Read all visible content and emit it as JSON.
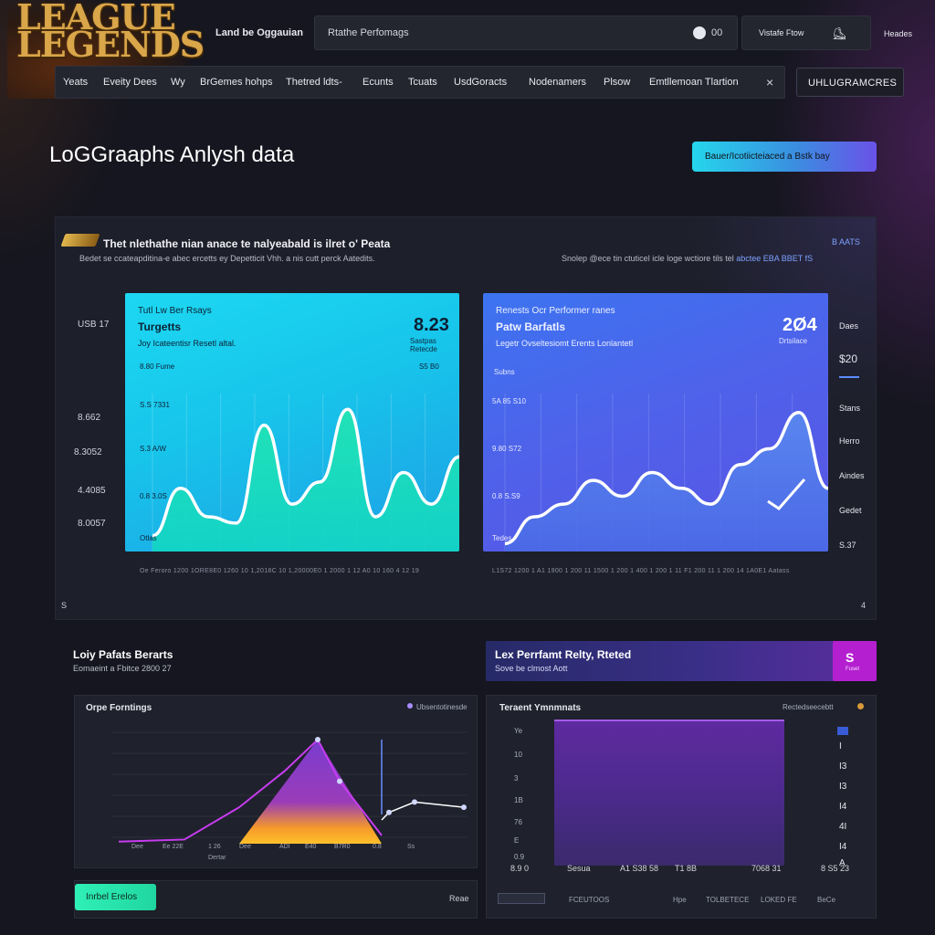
{
  "app": {
    "logo_line1": "LEAGUE",
    "logo_line2": "LEGENDS",
    "top_title": "Land be Oggauian",
    "search_text": "Rtathe Perfomags",
    "search_count": "00",
    "user_text": "Vistafe Ftow",
    "top_right": "Heades",
    "upgrade_button": "UHLUGRAMCRES",
    "nav_close": "×"
  },
  "nav": {
    "tabs": [
      "Yeats",
      "Eveity Dees",
      "Wy",
      "BrGemes hohps",
      "Thetred ldts-",
      "Ecunts",
      "Tcuats",
      "UsdGoracts",
      "Nodenamers",
      "Plsow",
      "Emtllemoan Tlartion"
    ]
  },
  "page": {
    "headline": "LoGGraaphs Anlysh data",
    "cta": "Bauer/Icotiicteiaced a Bstk bay"
  },
  "panel": {
    "title": "Thet nlethathe nian anace te nalyeabald is ilret o' Peata",
    "subtitle": "Bedet se ccateapditina-e abec ercetts ey Depetticit Vhh. a nis cutt perck Aatedits.",
    "right_sub_a": "Snolep @ece tin ctuticel icle loge wctiore tils tel",
    "right_sub_b": "abctee EBA BBET fS",
    "corner": "B AATS",
    "left_y_labels": [
      "USB 17",
      "8.662",
      "8.3052",
      "4.4085",
      "8.0057"
    ],
    "foot_left": "S",
    "foot_right": "4",
    "x_axis_left": "Oe Feroro 1200 1ORE8E0 1260 10 1,2018C 10 1,20000E0 1 2000 1 12 A0 10 160 4 12 19",
    "x_axis_right": "L1S72 1200 1 A1 1900 1 200 11 1500 1 200 1 400 1 200 1 11 F1 200 11 1 200 14 1A0E1 Aatass",
    "right_labels": [
      "Daes",
      "$20",
      "Stans",
      "Herro",
      "Aindes",
      "Gedet",
      "S.37"
    ]
  },
  "card_a": {
    "t1": "Tutl Lw Ber Rsays",
    "t2": "Turgetts",
    "t3": "Joy Icateentisr Resetl altal.",
    "big": "8.23",
    "big_sub": "Sastpas Retecde",
    "lbl_top_left": "8.80 Fume",
    "lbl_top_right": "S5 B0",
    "lbl_1": "S.S 7331",
    "lbl_2": "S.3 A/W",
    "lbl_3": "0.8 3.0S",
    "lbl_4": "Otlas"
  },
  "card_b": {
    "t1": "Renests Ocr Performer ranes",
    "t2": "Patw Barfatls",
    "t3": "Legetr Ovseltesiomt Erents Lonlantetl",
    "big": "2Ø4",
    "big_sub": "Drtsilace",
    "lbl_top_left": "Subns",
    "lbl_1": "5A 85 S10",
    "lbl_2": "9.80 S72",
    "lbl_3": "0.8 S.S9",
    "lbl_4": "Tedes"
  },
  "lower_left": {
    "title": "Loiy Pafats Berarts",
    "subtitle": "Eomaeint a Fbitce 2800 27",
    "box_title": "Orpe Forntings",
    "box_right": "Ubsentotinesde",
    "x_ticks": [
      "Dee",
      "Ee 22E",
      "1 26",
      "Dee",
      "ADI",
      "E40",
      "B7R0",
      "0.8",
      "Ss"
    ],
    "x_sub": "Dertar",
    "button": "Inrbel Erelos",
    "foot_right": "Reae"
  },
  "lower_right": {
    "banner_title": "Lex Perrfamt Relty, Rteted",
    "banner_sub": "Sove be clmost Aott",
    "badge": "S",
    "badge_sub": "Fuset",
    "box_title": "Teraent Ymnmnats",
    "box_right": "Rectedseecebtt",
    "y_ticks": [
      "Ye",
      "10",
      "3",
      "1B",
      "76",
      "E",
      "0.9",
      "5",
      "Bo"
    ],
    "right_ticks": [
      "I",
      "I3",
      "I3",
      "I4",
      "4I",
      "I4",
      "A",
      "2I"
    ],
    "x_ticks": [
      "Sesua",
      "A1 S38 58",
      "T1 8B",
      "7068 31",
      "8 S5 23"
    ],
    "x_first": "8.9 0",
    "foot": [
      "FCEUTOOS",
      "Hpe",
      "TOLBETECE",
      "LOKED FE"
    ],
    "foot_extra": "BeCe"
  },
  "colors": {
    "accent_cyan": "#1dd8f2",
    "accent_blue": "#4e62ea",
    "accent_purple": "#b41fd0",
    "accent_green": "#2ff0b6"
  },
  "chart_data": [
    {
      "type": "area",
      "title": "Turgetts",
      "series": [
        {
          "values": [
            10,
            40,
            22,
            18,
            80,
            30,
            44,
            90,
            22,
            50,
            30,
            60
          ]
        }
      ]
    },
    {
      "type": "area",
      "title": "Patw Barfatls",
      "series": [
        {
          "values": [
            5,
            22,
            30,
            45,
            35,
            50,
            40,
            30,
            55,
            65,
            88,
            40
          ]
        }
      ]
    },
    {
      "type": "line",
      "title": "Orpe Forntings",
      "series": [
        {
          "values": [
            2,
            4,
            35,
            70,
            100,
            60,
            8,
            30,
            40,
            35
          ]
        }
      ]
    }
  ]
}
